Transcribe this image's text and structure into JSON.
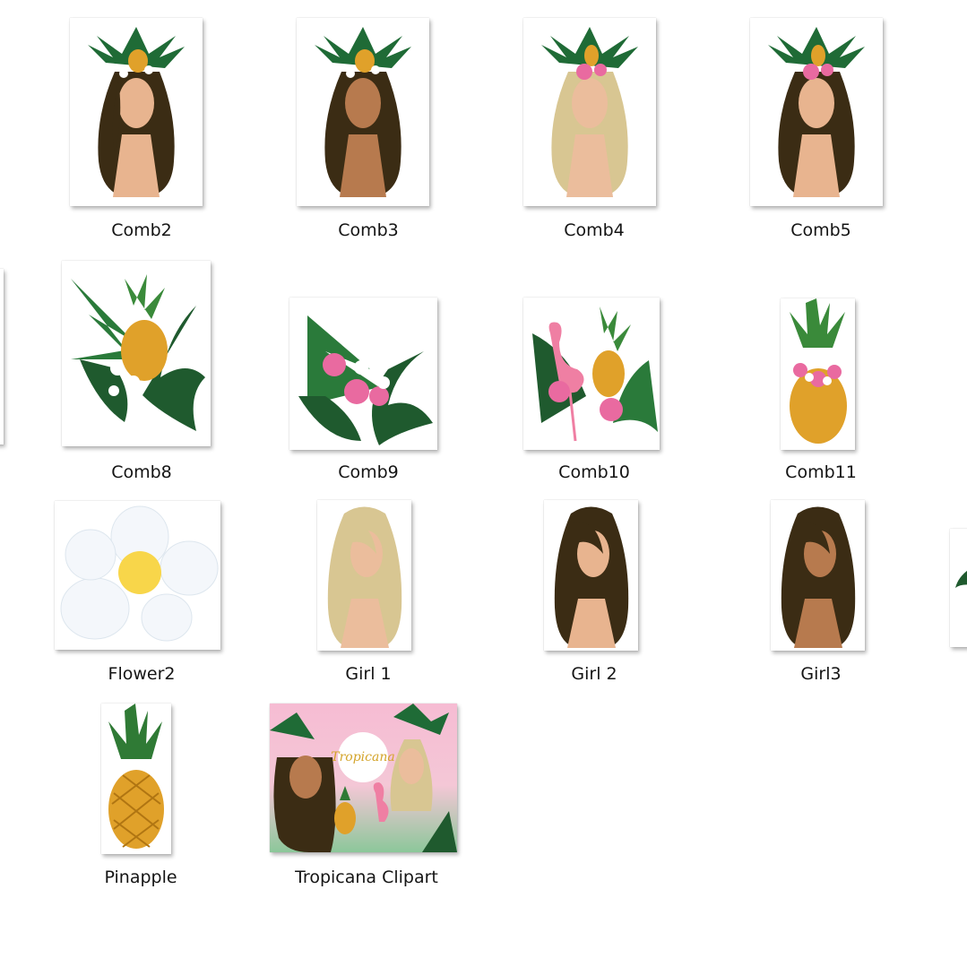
{
  "files": [
    {
      "name": "Comb2",
      "icon": "girl-pineapple-crown-dark-hair",
      "colors": {
        "hair": "#3b2c14",
        "skin": "#e8b48f"
      }
    },
    {
      "name": "Comb3",
      "icon": "girl-pineapple-crown-dark-skin",
      "colors": {
        "hair": "#3b2c14",
        "skin": "#b77a4e"
      }
    },
    {
      "name": "Comb4",
      "icon": "girl-hibiscus-crown-blonde",
      "colors": {
        "hair": "#d8c692",
        "skin": "#ebbd9c"
      }
    },
    {
      "name": "Comb5",
      "icon": "girl-hibiscus-crown-dark-hair",
      "colors": {
        "hair": "#3b2c14",
        "skin": "#e8b48f"
      }
    },
    {
      "name": "Comb8",
      "icon": "pineapple-palm-leaves-plumeria"
    },
    {
      "name": "Comb9",
      "icon": "monstera-hibiscus-bouquet"
    },
    {
      "name": "Comb10",
      "icon": "flamingo-pineapple-bouquet"
    },
    {
      "name": "Comb11",
      "icon": "pineapple-with-hibiscus"
    },
    {
      "name": "Flower2",
      "icon": "plumeria-flower"
    },
    {
      "name": "Girl 1",
      "icon": "girl-blonde",
      "colors": {
        "hair": "#d8c692",
        "skin": "#ebbd9c"
      }
    },
    {
      "name": "Girl 2",
      "icon": "girl-dark-hair",
      "colors": {
        "hair": "#3b2c14",
        "skin": "#e8b48f"
      }
    },
    {
      "name": "Girl3",
      "icon": "girl-dark-skin",
      "colors": {
        "hair": "#3b2c14",
        "skin": "#b77a4e"
      }
    },
    {
      "name": "Pinapple",
      "icon": "pineapple"
    },
    {
      "name": "Tropicana Clipart",
      "icon": "tropicana-cover-collage"
    }
  ],
  "partial_icons": [
    {
      "icon": "cut-off-thumbnail-left"
    },
    {
      "icon": "monstera-leaf-thumbnail-cut-off"
    }
  ]
}
